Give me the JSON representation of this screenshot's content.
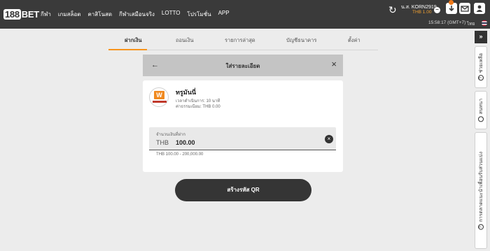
{
  "brand": {
    "prefix": "188",
    "suffix": "BET"
  },
  "nav": [
    "กีฬา",
    "เกมสล็อต",
    "คาสิโนสด",
    "กีฬาเสมือนจริง",
    "LOTTO",
    "โปรโมชั่น",
    "APP"
  ],
  "user": {
    "name": "น.ส. KORN2919",
    "balance": "THB 1.00"
  },
  "clock": "15:58:17 (GMT+7)",
  "language": "ไทย",
  "tabs": [
    "ฝากเงิน",
    "ถอนเงิน",
    "รายการล่าสุด",
    "บัญชีธนาคาร",
    "ตั้งค่า"
  ],
  "modal": {
    "title": "ใส่รายละเอียด"
  },
  "bank": {
    "name": "ทรูมันนี่",
    "processing_time": "เวลาดำเนินการ: 10 นาที",
    "fee": "ค่าธรรมเนียม: THB 0.00"
  },
  "amount": {
    "label": "จำนวนเงินที่ฝาก",
    "currency": "THB",
    "value": "100.00",
    "range": "THB 100.00 - 200,000.00"
  },
  "qr_button": "สร้างรหัส QR",
  "rail": {
    "toggle": "»",
    "items": [
      {
        "label": "ช่วยเหลือ",
        "icon": "help-icon"
      },
      {
        "label": "สนทนา",
        "icon": "headset-icon"
      },
      {
        "label": "การตลาดแนะนำเพื่อนรับส่วนแบ่ง",
        "icon": "referral-icon"
      }
    ]
  },
  "colors": {
    "topbar": "#3a3a3a",
    "accent": "#f7941d",
    "button": "#353535"
  }
}
